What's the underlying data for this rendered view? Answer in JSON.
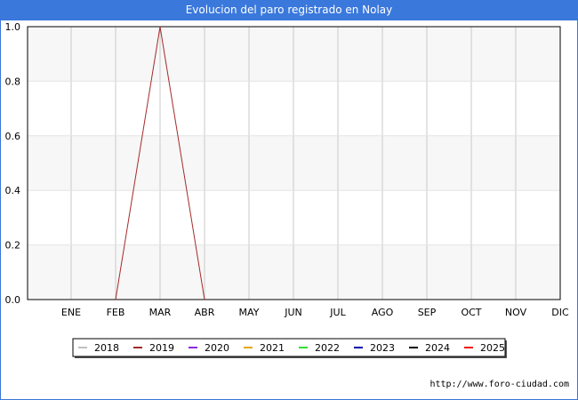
{
  "chart_data": {
    "type": "line",
    "title": "Evolucion del paro registrado en Nolay",
    "xlabel": "",
    "ylabel": "",
    "categories": [
      "ENE",
      "FEB",
      "MAR",
      "ABR",
      "MAY",
      "JUN",
      "JUL",
      "AGO",
      "SEP",
      "OCT",
      "NOV",
      "DIC"
    ],
    "ylim": [
      0,
      1
    ],
    "yticks": [
      "0.0",
      "0.2",
      "0.4",
      "0.6",
      "0.8",
      "1.0"
    ],
    "grid": true,
    "legend_position": "bottom",
    "series": [
      {
        "name": "2018",
        "color": "#c0c0c0",
        "values": []
      },
      {
        "name": "2019",
        "color": "#a52a2a",
        "values": [
          null,
          0,
          1,
          0,
          null,
          null,
          null,
          null,
          null,
          null,
          null,
          null
        ]
      },
      {
        "name": "2020",
        "color": "#8a2be2",
        "values": []
      },
      {
        "name": "2021",
        "color": "#e6a800",
        "values": []
      },
      {
        "name": "2022",
        "color": "#33dd33",
        "values": []
      },
      {
        "name": "2023",
        "color": "#0000aa",
        "values": []
      },
      {
        "name": "2024",
        "color": "#000000",
        "values": []
      },
      {
        "name": "2025",
        "color": "#ee1111",
        "values": []
      }
    ]
  },
  "source": "http://www.foro-ciudad.com"
}
